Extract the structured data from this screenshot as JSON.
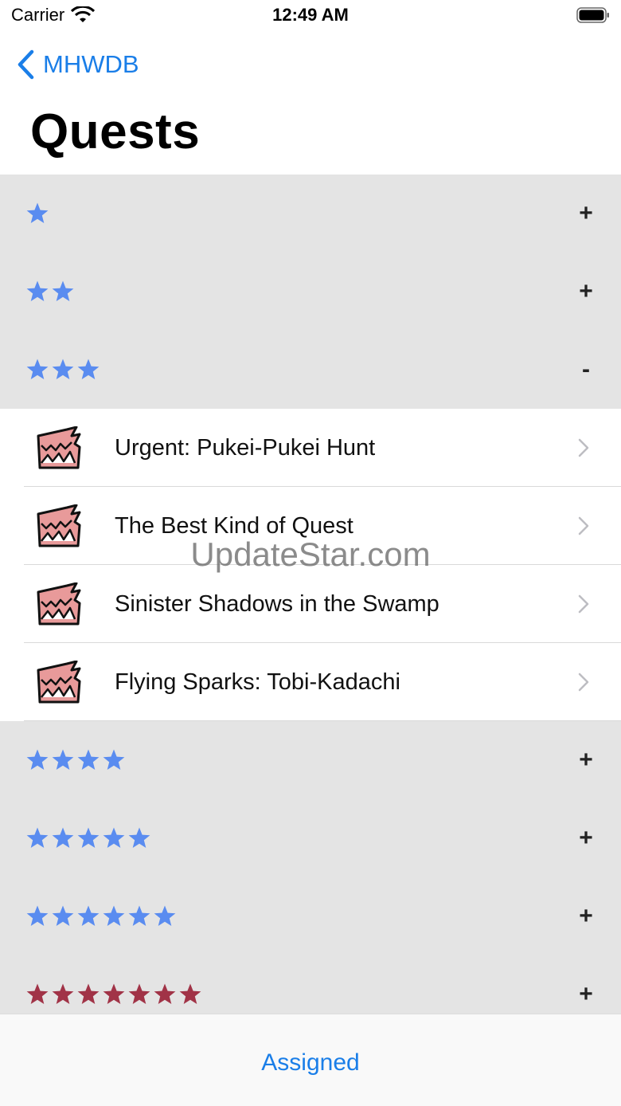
{
  "status_bar": {
    "carrier": "Carrier",
    "time": "12:49 AM"
  },
  "nav": {
    "back_label": "MHWDB",
    "title": "Quests"
  },
  "sections": [
    {
      "stars": 1,
      "toggle": "+",
      "star_color": "#5a8cf0",
      "expanded": false
    },
    {
      "stars": 2,
      "toggle": "+",
      "star_color": "#5a8cf0",
      "expanded": false
    },
    {
      "stars": 3,
      "toggle": "-",
      "star_color": "#5a8cf0",
      "expanded": true,
      "quests": [
        {
          "title": "Urgent: Pukei-Pukei Hunt",
          "icon": "monster-jaw-icon"
        },
        {
          "title": "The Best Kind of Quest",
          "icon": "monster-jaw-icon"
        },
        {
          "title": "Sinister Shadows in the Swamp",
          "icon": "monster-jaw-icon"
        },
        {
          "title": "Flying Sparks: Tobi-Kadachi",
          "icon": "monster-jaw-icon"
        }
      ]
    },
    {
      "stars": 4,
      "toggle": "+",
      "star_color": "#5a8cf0",
      "expanded": false
    },
    {
      "stars": 5,
      "toggle": "+",
      "star_color": "#5a8cf0",
      "expanded": false
    },
    {
      "stars": 6,
      "toggle": "+",
      "star_color": "#5a8cf0",
      "expanded": false
    },
    {
      "stars": 7,
      "toggle": "+",
      "star_color": "#a13347",
      "expanded": false
    }
  ],
  "watermark": "UpdateStar.com",
  "bottom": {
    "button_label": "Assigned"
  },
  "colors": {
    "accent": "#1a7ee8",
    "section_bg": "#e4e4e4",
    "icon_fill": "#e89a9a"
  }
}
